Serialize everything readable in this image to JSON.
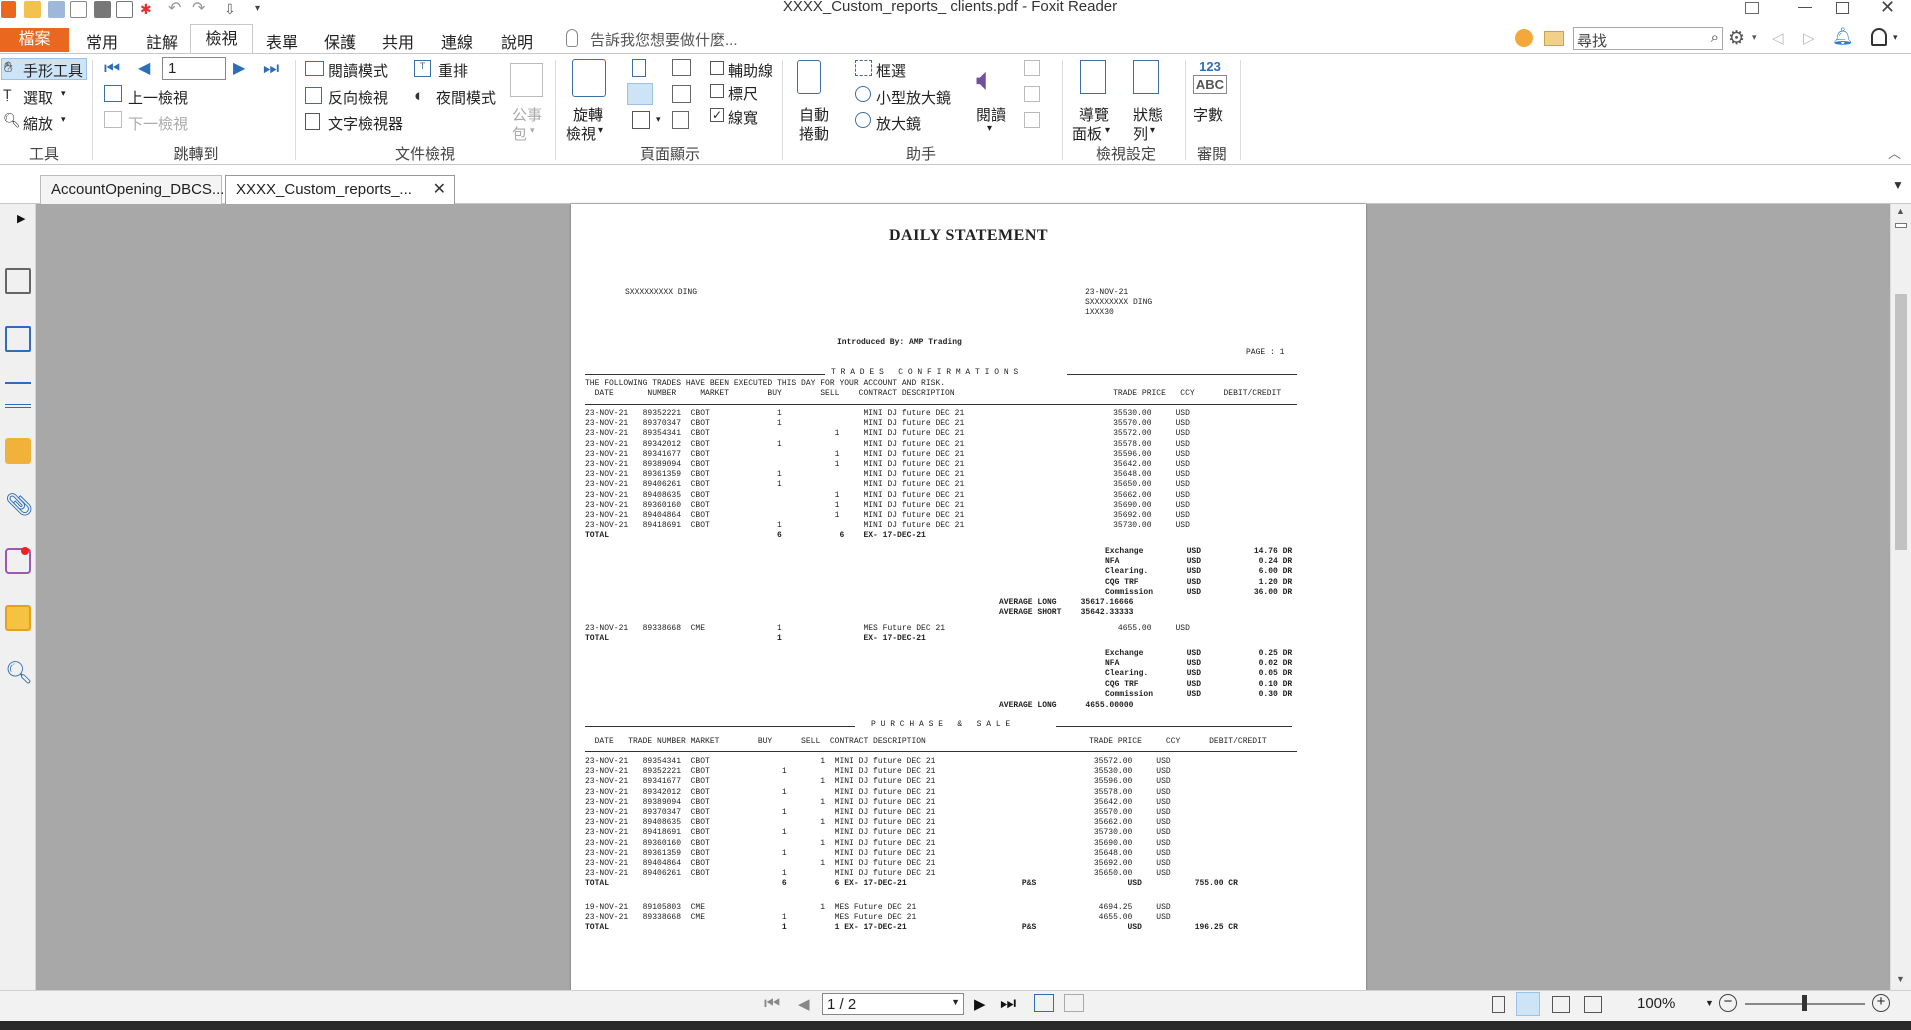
{
  "window": {
    "title": "XXXX_Custom_reports_ clients.pdf - Foxit Reader"
  },
  "menu": {
    "tabs": [
      "檔案",
      "常用",
      "註解",
      "檢視",
      "表單",
      "保護",
      "共用",
      "連線",
      "說明"
    ],
    "tell_me": "告訴我您想要做什麼...",
    "search_placeholder": "尋找"
  },
  "ribbon": {
    "tools": {
      "hand": "手形工具",
      "select": "選取",
      "zoom": "縮放",
      "group": "工具"
    },
    "goto": {
      "page_value": "1",
      "prev_view": "上一檢視",
      "next_view": "下一檢視",
      "group": "跳轉到"
    },
    "docview": {
      "read_mode": "閱讀模式",
      "reverse": "反向檢視",
      "text_viewer": "文字檢視器",
      "reflow": "重排",
      "night": "夜間模式",
      "public": "公事",
      "public2": "包",
      "group": "文件檢視"
    },
    "pagedisplay": {
      "rotate": "旋轉",
      "rotate2": "檢視",
      "guides": "輔助線",
      "ruler": "標尺",
      "lineweight": "線寬",
      "group": "頁面顯示"
    },
    "assist": {
      "autoscroll": "自動",
      "autoscroll2": "捲動",
      "marquee": "框選",
      "loupe": "小型放大鏡",
      "magnifier": "放大鏡",
      "read": "閱讀",
      "group": "助手"
    },
    "viewsettings": {
      "nav": "導覽",
      "nav2": "面板",
      "status": "狀態",
      "status2": "列",
      "group": "檢視設定"
    },
    "review": {
      "wordcount": "字數",
      "icon_text1": "123",
      "icon_text2": "ABC",
      "group": "審閱"
    }
  },
  "doc_tabs": [
    "AccountOpening_DBCS...",
    "XXXX_Custom_reports_..."
  ],
  "statusbar": {
    "page_indicator": "1 / 2",
    "zoom": "100%"
  },
  "document": {
    "title": "DAILY STATEMENT",
    "left_header": "SXXXXXXXXX DING",
    "right_header_1": "23-NOV-21",
    "right_header_2": "SXXXXXXXX DING",
    "right_header_3": "1XXX30",
    "introduced_by": "Introduced By: AMP Trading",
    "page_label": "PAGE : 1",
    "tc_heading": "T R A D E S   C O N F I R M A T I O N S",
    "tc_subheading": "THE FOLLOWING TRADES HAVE BEEN EXECUTED THIS DAY FOR YOUR ACCOUNT AND RISK.",
    "tc_columns": "  DATE       NUMBER     MARKET        BUY        SELL    CONTRACT DESCRIPTION                                 TRADE PRICE   CCY      DEBIT/CREDIT",
    "tc_rows": [
      "23-NOV-21   89352221  CBOT              1                 MINI DJ future DEC 21                               35530.00     USD",
      "23-NOV-21   89370347  CBOT              1                 MINI DJ future DEC 21                               35570.00     USD",
      "23-NOV-21   89354341  CBOT                          1     MINI DJ future DEC 21                               35572.00     USD",
      "23-NOV-21   89342012  CBOT              1                 MINI DJ future DEC 21                               35578.00     USD",
      "23-NOV-21   89341677  CBOT                          1     MINI DJ future DEC 21                               35596.00     USD",
      "23-NOV-21   89389094  CBOT                          1     MINI DJ future DEC 21                               35642.00     USD",
      "23-NOV-21   89361359  CBOT              1                 MINI DJ future DEC 21                               35648.00     USD",
      "23-NOV-21   89406261  CBOT              1                 MINI DJ future DEC 21                               35650.00     USD",
      "23-NOV-21   89408635  CBOT                          1     MINI DJ future DEC 21                               35662.00     USD",
      "23-NOV-21   89360160  CBOT                          1     MINI DJ future DEC 21                               35690.00     USD",
      "23-NOV-21   89404864  CBOT                          1     MINI DJ future DEC 21                               35692.00     USD",
      "23-NOV-21   89418691  CBOT              1                 MINI DJ future DEC 21                               35730.00     USD"
    ],
    "tc_total": "TOTAL                                   6            6    EX- 17-DEC-21",
    "fees_1": [
      "Exchange         USD           14.76 DR",
      "NFA              USD            0.24 DR",
      "Clearing.        USD            6.00 DR",
      "CQG TRF          USD            1.20 DR",
      "Commission       USD           36.00 DR"
    ],
    "avg_1": [
      "AVERAGE LONG     35617.16666",
      "AVERAGE SHORT    35642.33333"
    ],
    "cme_row": "23-NOV-21   89338668  CME               1                 MES Future DEC 21                                    4655.00     USD",
    "cme_total": "TOTAL                                   1                 EX- 17-DEC-21",
    "fees_2": [
      "Exchange         USD            0.25 DR",
      "NFA              USD            0.02 DR",
      "Clearing.        USD            0.05 DR",
      "CQG TRF          USD            0.10 DR",
      "Commission       USD            0.30 DR"
    ],
    "avg_2": "AVERAGE LONG      4655.00000",
    "ps_heading": "P U R C H A S E   &   S A L E",
    "ps_columns": "  DATE   TRADE NUMBER MARKET        BUY      SELL  CONTRACT DESCRIPTION                                  TRADE PRICE     CCY      DEBIT/CREDIT",
    "ps_rows": [
      "23-NOV-21   89354341  CBOT                       1  MINI DJ future DEC 21                                 35572.00     USD",
      "23-NOV-21   89352221  CBOT               1          MINI DJ future DEC 21                                 35530.00     USD",
      "23-NOV-21   89341677  CBOT                       1  MINI DJ future DEC 21                                 35596.00     USD",
      "23-NOV-21   89342012  CBOT               1          MINI DJ future DEC 21                                 35578.00     USD",
      "23-NOV-21   89389094  CBOT                       1  MINI DJ future DEC 21                                 35642.00     USD",
      "23-NOV-21   89370347  CBOT               1          MINI DJ future DEC 21                                 35570.00     USD",
      "23-NOV-21   89408635  CBOT                       1  MINI DJ future DEC 21                                 35662.00     USD",
      "23-NOV-21   89418691  CBOT               1          MINI DJ future DEC 21                                 35730.00     USD",
      "23-NOV-21   89360160  CBOT                       1  MINI DJ future DEC 21                                 35690.00     USD",
      "23-NOV-21   89361359  CBOT               1          MINI DJ future DEC 21                                 35648.00     USD",
      "23-NOV-21   89404864  CBOT                       1  MINI DJ future DEC 21                                 35692.00     USD",
      "23-NOV-21   89406261  CBOT               1          MINI DJ future DEC 21                                 35650.00     USD"
    ],
    "ps_total": "TOTAL                                    6          6 EX- 17-DEC-21                        P&S                   USD           755.00 CR",
    "ps_cme_rows": [
      "19-NOV-21   89105803  CME                        1  MES Future DEC 21                                      4694.25     USD",
      "23-NOV-21   89338668  CME                1          MES Future DEC 21                                      4655.00     USD"
    ],
    "ps_cme_total": "TOTAL                                    1          1 EX- 17-DEC-21                        P&S                   USD           196.25 CR"
  }
}
